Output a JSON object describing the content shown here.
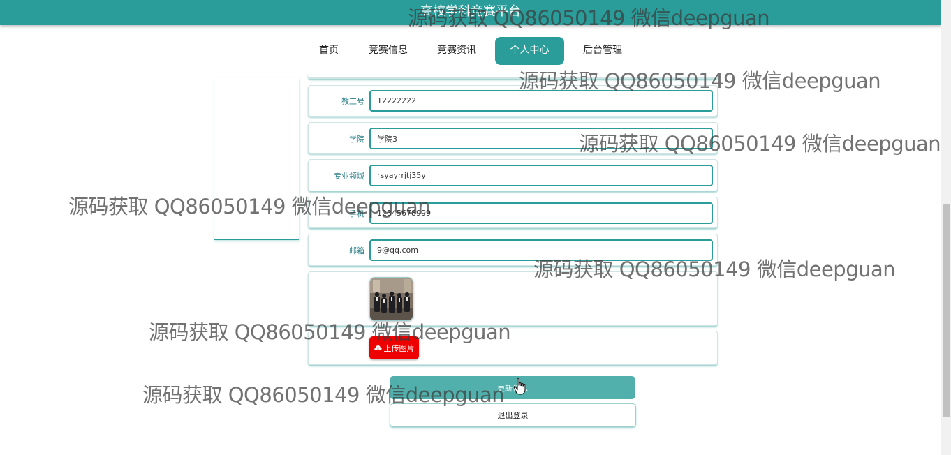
{
  "header": {
    "site_title": "高校学科竞赛平台"
  },
  "nav": {
    "items": [
      {
        "label": "首页"
      },
      {
        "label": "竞赛信息"
      },
      {
        "label": "竞赛资讯"
      },
      {
        "label": "个人中心",
        "active": true
      },
      {
        "label": "后台管理"
      }
    ]
  },
  "form": {
    "fields": [
      {
        "label": "教工号",
        "value": "12222222"
      },
      {
        "label": "学院",
        "value": "学院3"
      },
      {
        "label": "专业领域",
        "value": "rsyayrrjtj35y"
      },
      {
        "label": "手机",
        "value": "12345678999"
      },
      {
        "label": "邮箱",
        "value": "9@qq.com"
      }
    ],
    "upload_label": "上传图片",
    "upload_icon": "cloud-upload-icon",
    "update_label": "更新信息",
    "logout_label": "退出登录"
  },
  "watermark": "源码获取 QQ86050149 微信deepguan",
  "colors": {
    "accent": "#2a9d9a",
    "upload": "#ee0000",
    "update": "#52b0ac"
  }
}
